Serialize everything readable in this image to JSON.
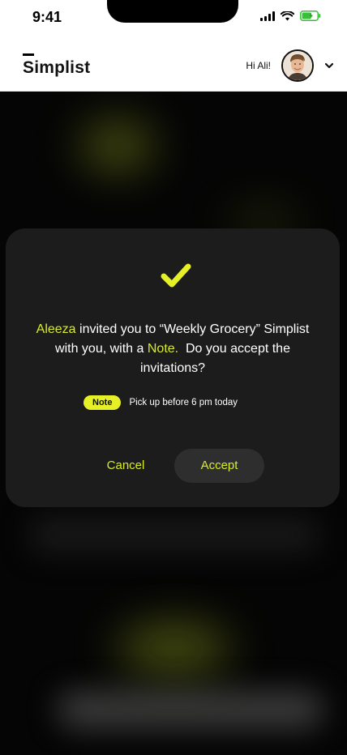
{
  "status_bar": {
    "time": "9:41",
    "icons": [
      "cellular-signal-icon",
      "wifi-icon",
      "battery-charging-icon"
    ]
  },
  "header": {
    "logo": "Simplist",
    "greeting": "Hi Ali!",
    "avatar": "user-avatar",
    "menu_icon": "chevron-down-icon"
  },
  "modal": {
    "icon": "check-icon",
    "message": {
      "inviter": "Aleeza",
      "text_1": " invited you to “Weekly Grocery” Simplist with you, with a ",
      "note_word": "Note.",
      "text_2": "  Do you accept the invitations?"
    },
    "note": {
      "badge": "Note",
      "text": "Pick up before 6 pm today"
    },
    "buttons": {
      "cancel": "Cancel",
      "accept": "Accept"
    }
  },
  "colors": {
    "accent": "#d8eb2d",
    "note_badge": "#e6f026",
    "modal_bg": "#1c1c1c",
    "accept_bg": "#2e2e2e",
    "backdrop": "#050505"
  }
}
